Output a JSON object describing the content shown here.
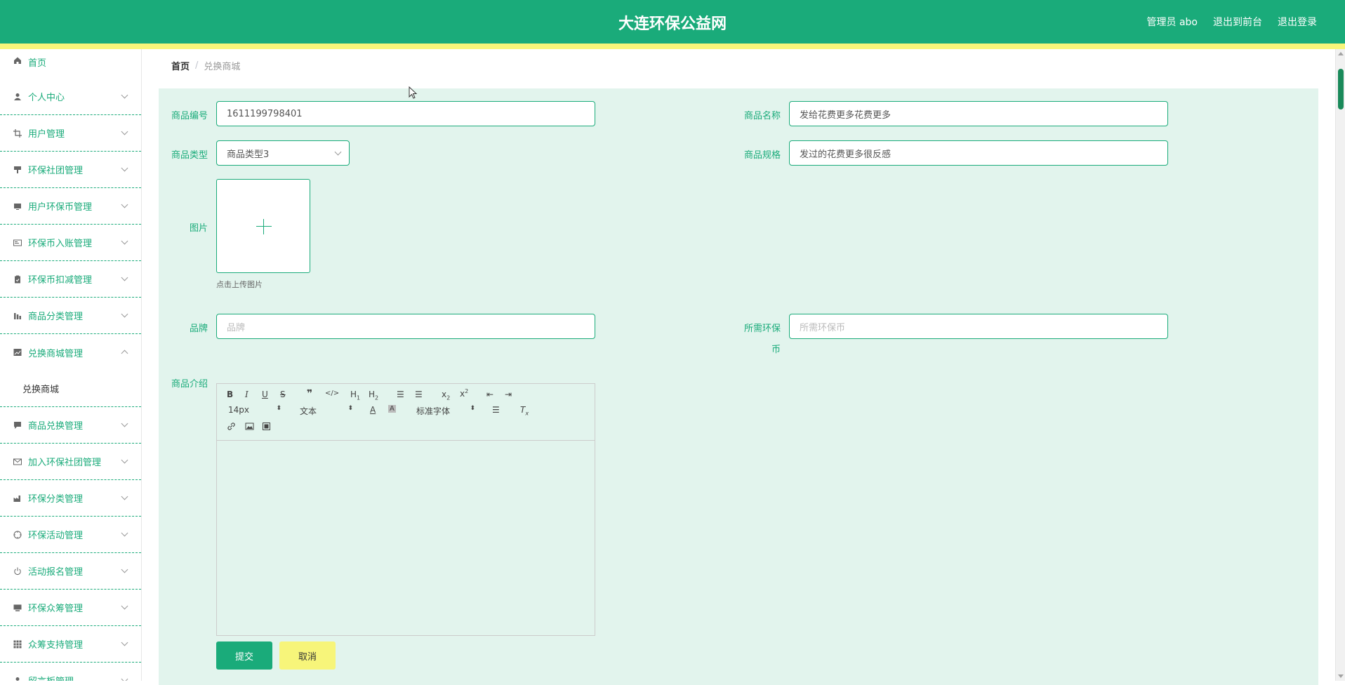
{
  "header": {
    "title": "大连环保公益网",
    "links": [
      "管理员 abo",
      "退出到前台",
      "退出登录"
    ]
  },
  "sidebar": {
    "home": {
      "label": "首页",
      "icon": "home-icon"
    },
    "items": [
      {
        "label": "个人中心",
        "icon": "user-icon"
      },
      {
        "label": "用户管理",
        "icon": "crop-icon"
      },
      {
        "label": "环保社团管理",
        "icon": "brush-icon"
      },
      {
        "label": "用户环保币管理",
        "icon": "monitor-icon"
      },
      {
        "label": "环保币入账管理",
        "icon": "card-icon"
      },
      {
        "label": "环保币扣减管理",
        "icon": "clipboard-icon"
      },
      {
        "label": "商品分类管理",
        "icon": "chart-icon"
      },
      {
        "label": "兑换商城管理",
        "icon": "trend-icon",
        "open": true,
        "sub": [
          "兑换商城"
        ]
      },
      {
        "label": "商品兑换管理",
        "icon": "chat-icon"
      },
      {
        "label": "加入环保社团管理",
        "icon": "mail-icon"
      },
      {
        "label": "环保分类管理",
        "icon": "factory-icon"
      },
      {
        "label": "环保活动管理",
        "icon": "target-icon"
      },
      {
        "label": "活动报名管理",
        "icon": "power-icon"
      },
      {
        "label": "环保众筹管理",
        "icon": "screen-icon"
      },
      {
        "label": "众筹支持管理",
        "icon": "grid-icon"
      },
      {
        "label": "留言板管理",
        "icon": "person-icon"
      }
    ]
  },
  "breadcrumb": {
    "home": "首页",
    "separator": "/",
    "current": "兑换商城"
  },
  "form": {
    "code_label": "商品编号",
    "code_value": "1611199798401",
    "name_label": "商品名称",
    "name_value": "发给花费更多花费更多",
    "type_label": "商品类型",
    "type_value": "商品类型3",
    "spec_label": "商品规格",
    "spec_value": "发过的花费更多很反感",
    "image_label": "图片",
    "upload_tip": "点击上传图片",
    "brand_label": "品牌",
    "brand_placeholder": "品牌",
    "coins_label": "所需环保",
    "coins_label_wrap": "币",
    "coins_placeholder": "所需环保币",
    "intro_label": "商品介绍",
    "submit": "提交",
    "cancel": "取消"
  },
  "editor": {
    "font_size": "14px",
    "heading": "文本",
    "font_family": "标准字体"
  },
  "colors": {
    "primary": "#1aab7a",
    "accent_yellow": "#f7f57a",
    "panel_bg": "#e2f4ed"
  }
}
